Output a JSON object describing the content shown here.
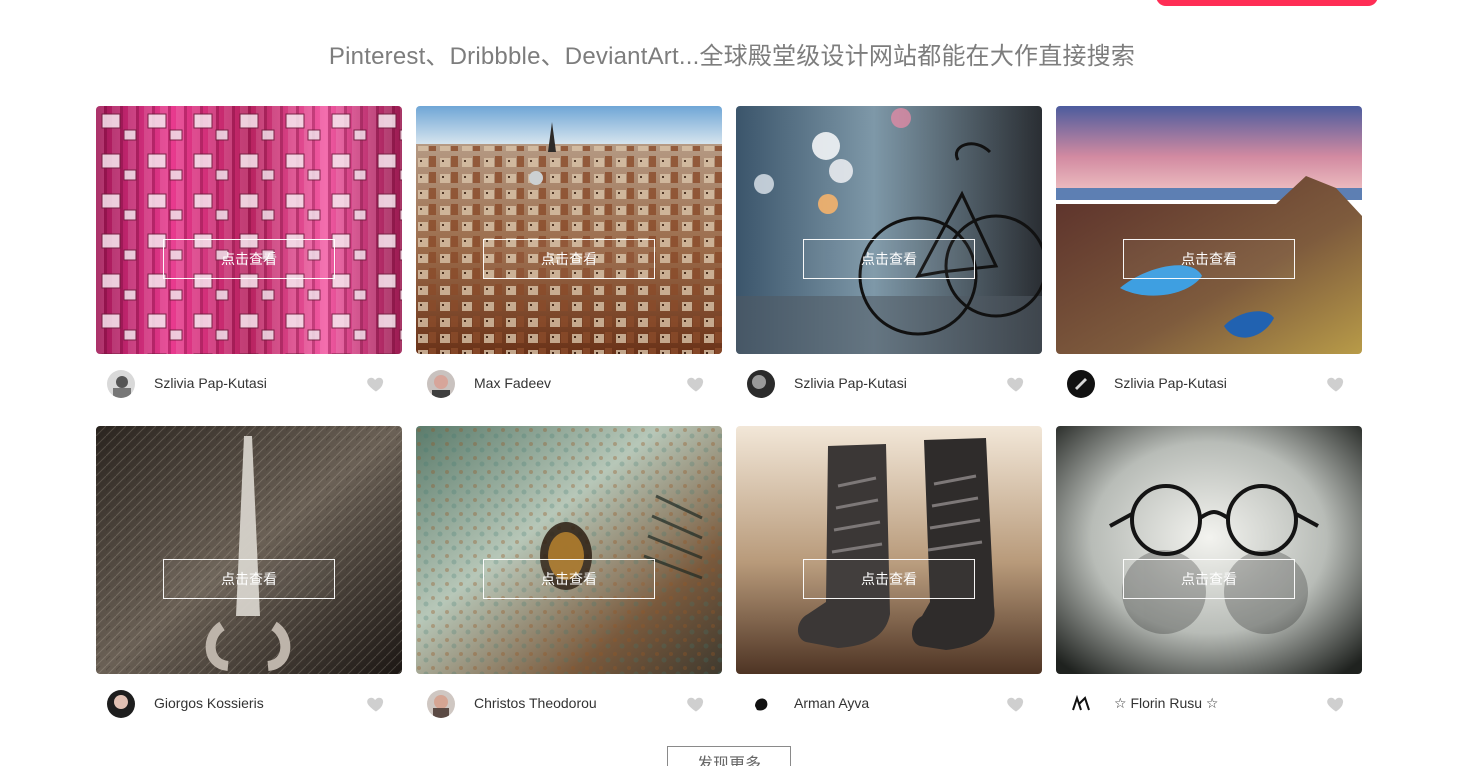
{
  "header": {
    "subtitle": "Pinterest、Dribbble、DeviantArt...全球殿堂级设计网站都能在大作直接搜索"
  },
  "gallery": {
    "view_label": "点击查看",
    "cards": [
      {
        "author": "Szlivia Pap-Kutasi",
        "image": "pink-building-facade"
      },
      {
        "author": "Max Fadeev",
        "image": "city-rooftops"
      },
      {
        "author": "Szlivia Pap-Kutasi",
        "image": "bicycle-bokeh"
      },
      {
        "author": "Szlivia Pap-Kutasi",
        "image": "coastal-landscape"
      },
      {
        "author": "Giorgos Kossieris",
        "image": "scissors-on-fur"
      },
      {
        "author": "Christos Theodorou",
        "image": "rusty-vehicle"
      },
      {
        "author": "Arman Ayva",
        "image": "worn-boots"
      },
      {
        "author": "☆ Florin Rusu ☆",
        "image": "eyeglasses"
      }
    ]
  },
  "footer": {
    "more_label": "发现更多"
  },
  "colors": {
    "accent": "#ff2d55",
    "heart": "#cfcfcf"
  }
}
